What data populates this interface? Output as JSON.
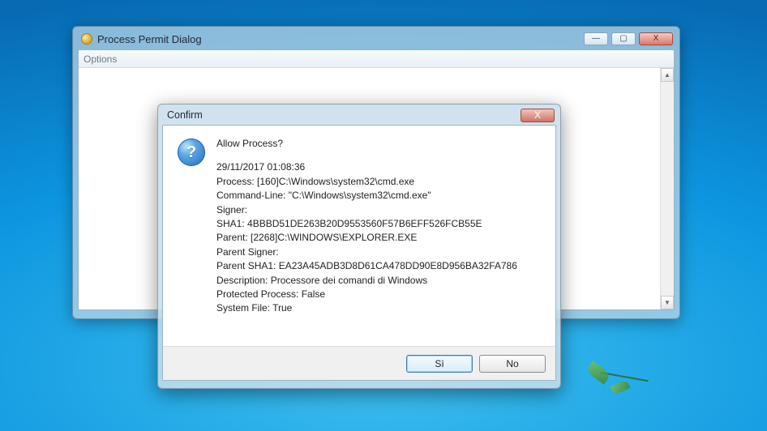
{
  "wallpaper": {
    "name": "windows-7-default"
  },
  "main_window": {
    "title": "Process Permit Dialog",
    "menubar": {
      "options": "Options"
    },
    "controls": {
      "minimize": "—",
      "maximize": "▢",
      "close": "X"
    }
  },
  "dialog": {
    "title": "Confirm",
    "close": "X",
    "icon": "question-icon",
    "heading": "Allow Process?",
    "lines": {
      "timestamp": "29/11/2017 01:08:36",
      "process": "Process: [160]C:\\Windows\\system32\\cmd.exe",
      "commandline": "Command-Line: \"C:\\Windows\\system32\\cmd.exe\"",
      "signer": "Signer:",
      "sha1": "SHA1: 4BBBD51DE263B20D9553560F57B6EFF526FCB55E",
      "parent": "Parent: [2268]C:\\WINDOWS\\EXPLORER.EXE",
      "parent_signer": "Parent Signer:",
      "parent_sha1": "Parent SHA1: EA23A45ADB3D8D61CA478DD90E8D956BA32FA786",
      "description": "Description: Processore dei comandi di Windows",
      "protected": "Protected Process: False",
      "system_file": "System File: True"
    },
    "buttons": {
      "yes": "Sì",
      "no": "No"
    }
  }
}
